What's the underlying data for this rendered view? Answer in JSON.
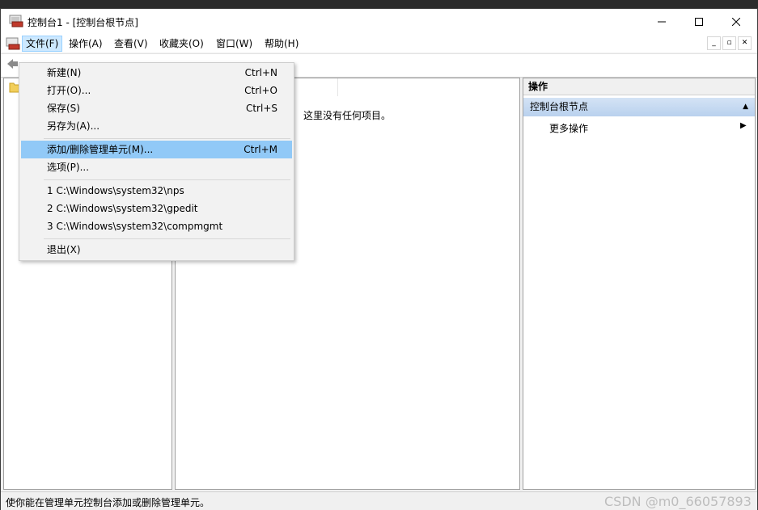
{
  "window": {
    "title": "控制台1 - [控制台根节点]"
  },
  "menubar": {
    "items": [
      "文件(F)",
      "操作(A)",
      "查看(V)",
      "收藏夹(O)",
      "窗口(W)",
      "帮助(H)"
    ],
    "active": "文件(F)"
  },
  "file_menu": {
    "new": {
      "label": "新建(N)",
      "shortcut": "Ctrl+N"
    },
    "open": {
      "label": "打开(O)...",
      "shortcut": "Ctrl+O"
    },
    "save": {
      "label": "保存(S)",
      "shortcut": "Ctrl+S"
    },
    "save_as": {
      "label": "另存为(A)..."
    },
    "add_remove": {
      "label": "添加/删除管理单元(M)...",
      "shortcut": "Ctrl+M"
    },
    "options": {
      "label": "选项(P)..."
    },
    "recent": [
      "1 C:\\Windows\\system32\\nps",
      "2 C:\\Windows\\system32\\gpedit",
      "3 C:\\Windows\\system32\\compmgmt"
    ],
    "exit": {
      "label": "退出(X)"
    }
  },
  "center": {
    "empty_message": "这里没有任何项目。"
  },
  "actions": {
    "header": "操作",
    "section": "控制台根节点",
    "more": "更多操作"
  },
  "status": {
    "text": "使你能在管理单元控制台添加或删除管理单元。",
    "watermark": "CSDN @m0_66057893"
  },
  "colors": {
    "menu_highlight": "#91c9f7",
    "active_menu_bg": "#cce8ff",
    "section_bg": "#c6daf1"
  }
}
